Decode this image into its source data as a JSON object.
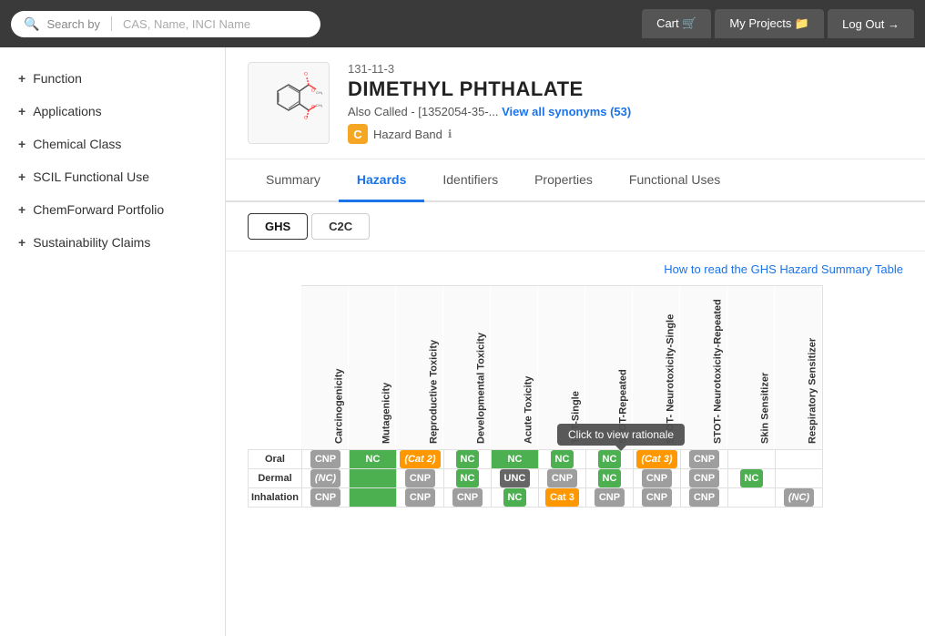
{
  "nav": {
    "search_label": "Search by",
    "search_placeholder": "CAS, Name, INCI Name",
    "tabs": [
      {
        "label": "Cart",
        "icon": "🛒"
      },
      {
        "label": "My Projects",
        "icon": "📁"
      },
      {
        "label": "Log Out",
        "icon": "→"
      }
    ]
  },
  "sidebar": {
    "items": [
      {
        "label": "Function"
      },
      {
        "label": "Applications"
      },
      {
        "label": "Chemical Class"
      },
      {
        "label": "SCIL Functional Use"
      },
      {
        "label": "ChemForward Portfolio"
      },
      {
        "label": "Sustainability Claims"
      }
    ]
  },
  "chemical": {
    "cas": "131-11-3",
    "name": "DIMETHYL PHTHALATE",
    "also_called_prefix": "Also Called - [1352054-35-...",
    "synonyms_link": "View all synonyms (53)",
    "hazard_band_letter": "C",
    "hazard_band_label": "Hazard Band"
  },
  "tabs": [
    {
      "label": "Summary"
    },
    {
      "label": "Hazards",
      "active": true
    },
    {
      "label": "Identifiers"
    },
    {
      "label": "Properties"
    },
    {
      "label": "Functional Uses"
    }
  ],
  "sub_tabs": [
    {
      "label": "GHS",
      "active": true
    },
    {
      "label": "C2C"
    }
  ],
  "ghs_link": "How to read the GHS Hazard Summary Table",
  "tooltip": "Click to view rationale",
  "table_headers": [
    "Carcinogenicity",
    "Mutagenicity",
    "Reproductive Toxicity",
    "Developmental Toxicity",
    "Acute Toxicity",
    "TOT-Single",
    "STOT-Repeated",
    "STOT- Neurotoxicity-Single",
    "STOT- Neurotoxicity-Repeated",
    "Skin Sensitizer",
    "Respiratory Sensitizer"
  ],
  "rows": [
    {
      "label": "Oral",
      "cells": [
        "CNP",
        "NC",
        "(Cat 2)",
        "NC",
        "NC",
        "NC",
        "NC",
        "(Cat 3)",
        "CNP",
        "",
        ""
      ]
    },
    {
      "label": "Dermal",
      "cells": [
        "(NC)",
        "",
        "CNP",
        "NC",
        "UNC",
        "CNP",
        "NC",
        "CNP",
        "CNP",
        "NC",
        ""
      ]
    },
    {
      "label": "Inhalation",
      "cells": [
        "CNP",
        "",
        "CNP",
        "CNP",
        "NC",
        "Cat 3",
        "CNP",
        "CNP",
        "CNP",
        "",
        "(NC)"
      ]
    }
  ]
}
